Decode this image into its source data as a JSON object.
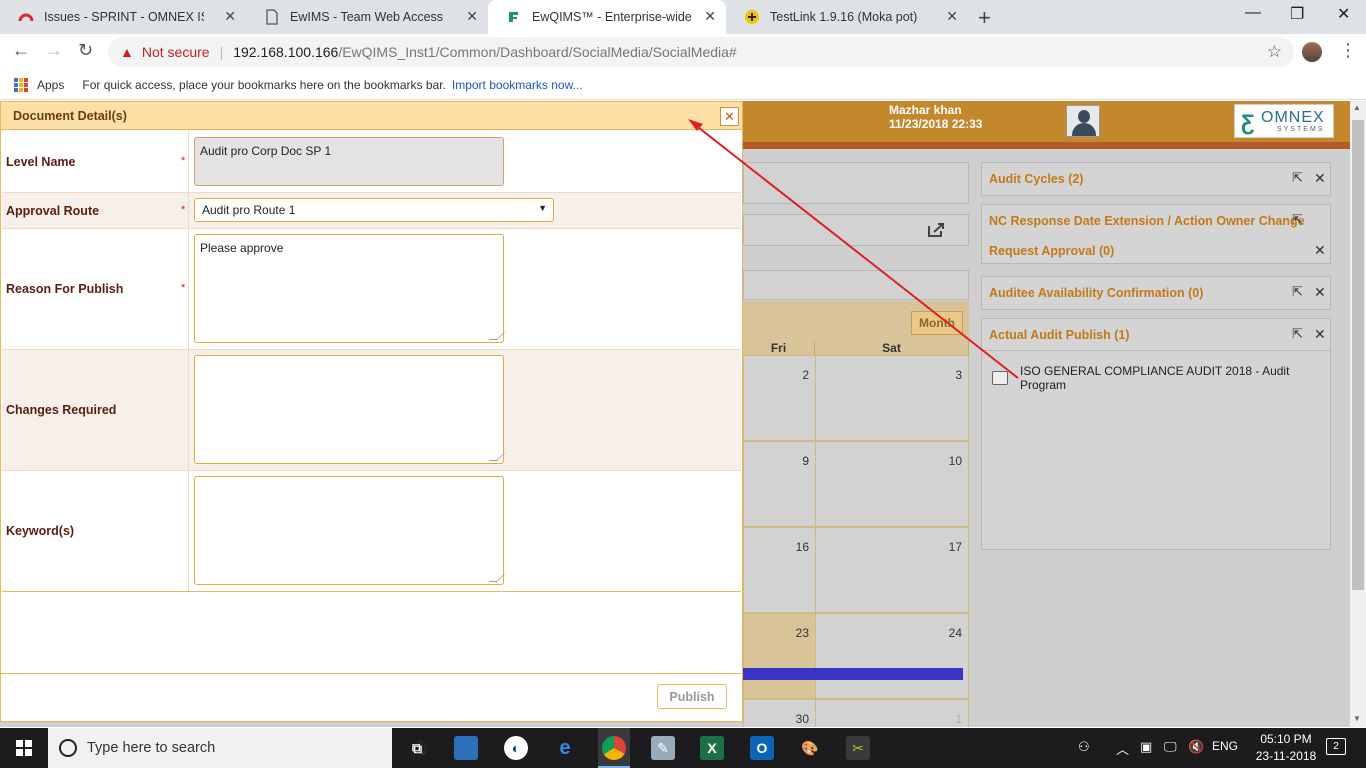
{
  "browser": {
    "tabs": [
      {
        "label": "Issues - SPRINT - OMNEX ISSUE T",
        "active": false
      },
      {
        "label": "EwIMS - Team Web Access",
        "active": false
      },
      {
        "label": "EwQIMS™ - Enterprise-wide Qua",
        "active": true
      },
      {
        "label": "TestLink 1.9.16 (Moka pot)",
        "active": false
      }
    ],
    "security_label": "Not secure",
    "url_host": "192.168.100.166",
    "url_path": "/EwQIMS_Inst1/Common/Dashboard/SocialMedia/SocialMedia#",
    "bookmarks": {
      "apps_label": "Apps",
      "hint": "For quick access, place your bookmarks here on the bookmarks bar.",
      "import_link": "Import bookmarks now..."
    }
  },
  "app": {
    "user_name": "Mazhar khan",
    "datetime": "11/23/2018 22:33",
    "logo_name": "OMNEX",
    "logo_sub": "SYSTEMS",
    "accent_color": "#c4882c"
  },
  "calendar": {
    "view_button": "Month",
    "day_headers": [
      "Fri",
      "Sat"
    ],
    "days": [
      "2",
      "3",
      "9",
      "10",
      "16",
      "17",
      "23",
      "24",
      "30",
      "1"
    ],
    "today": "23"
  },
  "widgets": [
    {
      "title": "Audit Cycles (2)"
    },
    {
      "title": "NC Response Date Extension / Action Owner Change",
      "subtitle": "Request Approval (0)"
    },
    {
      "title": "Auditee Availability Confirmation (0)"
    },
    {
      "title": "Actual Audit Publish (1)",
      "items": [
        "ISO GENERAL COMPLIANCE AUDIT 2018 - Audit Program"
      ]
    }
  ],
  "dialog": {
    "title": "Document Detail(s)",
    "close_icon": "close-icon",
    "fields": {
      "level_name": {
        "label": "Level Name",
        "value": "Audit pro Corp Doc SP 1",
        "required": "*"
      },
      "approval_route": {
        "label": "Approval Route",
        "value": "Audit pro Route 1",
        "required": "*"
      },
      "reason": {
        "label": "Reason For Publish",
        "value": "Please approve",
        "required": "*"
      },
      "changes": {
        "label": "Changes Required",
        "value": ""
      },
      "keywords": {
        "label": "Keyword(s)",
        "value": ""
      }
    },
    "publish_label": "Publish"
  },
  "taskbar": {
    "search_placeholder": "Type here to search",
    "language": "ENG",
    "time": "05:10 PM",
    "date": "23-11-2018",
    "notification_count": "2"
  }
}
